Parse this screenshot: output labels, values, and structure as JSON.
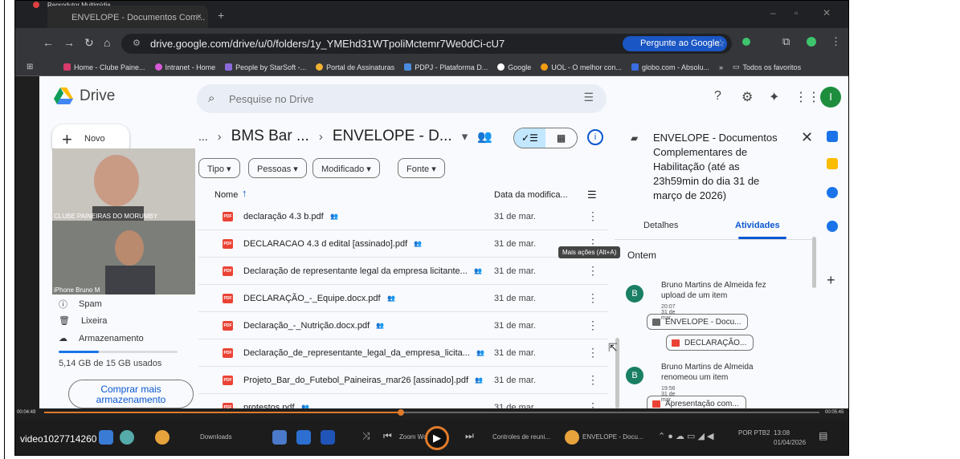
{
  "player": {
    "app_title": "Reprodutor Multimídia",
    "video_name": "video1027714260",
    "time_current": "00:04:49",
    "time_total": "00:05:45",
    "progress": 0.46
  },
  "browser": {
    "tab_title": "ENVELOPE - Documentos Com...",
    "url": "drive.google.com/drive/u/0/folders/1y_YMEhd31WTpoliMctemr7We0dCi-cU7",
    "ask_google": "Pergunte ao Google",
    "bookmarks": [
      "Home - Clube Paine...",
      "Intranet - Home",
      "People by StarSoft -...",
      "Portal de Assinaturas",
      "PDPJ - Plataforma D...",
      "Google",
      "UOL - O melhor con...",
      "globo.com - Absolu...",
      "»",
      "Todos os favoritos"
    ]
  },
  "drive": {
    "logo": "Drive",
    "search_placeholder": "Pesquise no Drive",
    "avatar_letter": "I",
    "new_label": "Novo",
    "nav": {
      "spam": "Spam",
      "trash": "Lixeira",
      "storage": "Armazenamento"
    },
    "storage_used": "5,14 GB de 15 GB usados",
    "storage_fraction": 0.34,
    "buy_more": "Comprar mais armazenamento",
    "cams": [
      {
        "label": "CLUBE PAINEIRAS DO MORUMBY"
      },
      {
        "label": "iPhone Bruno M"
      }
    ],
    "breadcrumb": [
      "...",
      "BMS Bar ...",
      "ENVELOPE - D..."
    ],
    "filters": [
      "Tipo",
      "Pessoas",
      "Modificado",
      "Fonte"
    ],
    "columns": {
      "name": "Nome",
      "date": "Data da modifica..."
    },
    "files": [
      {
        "name": "declaração 4.3 b.pdf",
        "date": "31 de mar."
      },
      {
        "name": "DECLARACAO 4.3 d edital [assinado].pdf",
        "date": "31 de mar."
      },
      {
        "name": "Declaração de representante legal da empresa licitante...",
        "date": "31 de mar."
      },
      {
        "name": "DECLARAÇÃO_-_Equipe.docx.pdf",
        "date": "31 de mar."
      },
      {
        "name": "Declaração_-_Nutrição.docx.pdf",
        "date": "31 de mar."
      },
      {
        "name": "Declaração_de_representante_legal_da_empresa_licita...",
        "date": "31 de mar."
      },
      {
        "name": "Projeto_Bar_do_Futebol_Paineiras_mar26 [assinado].pdf",
        "date": "31 de mar."
      },
      {
        "name": "protestos.pdf",
        "date": "31 de mar."
      }
    ],
    "tooltip": "Mais ações (Alt+A)",
    "panel": {
      "title": "ENVELOPE - Documentos Complementares de Habilitação (até as 23h59min do dia 31 de março de 2026)",
      "tab_details": "Detalhes",
      "tab_activity": "Atividades",
      "section": "Ontem",
      "activities": [
        {
          "avatar": "B",
          "text": "Bruno Martins de Almeida fez upload de um item",
          "time": "20:07 31 de mar.",
          "chips": [
            "ENVELOPE - Docu...",
            "DECLARAÇÃO..."
          ]
        },
        {
          "avatar": "B",
          "text": "Bruno Martins de Almeida renomeou um item",
          "time": "19:56 31 de mar.",
          "chips": [
            "Apresentação com..."
          ]
        }
      ]
    }
  },
  "taskbar": {
    "downloads": "Downloads",
    "zoom": "Zoom Workplace",
    "zoom_controls": "Controles de reuni...",
    "chrome_window": "ENVELOPE - Docu...",
    "lang": "POR PTB2",
    "clock": "13:08",
    "date": "01/04/2026"
  },
  "colors": {
    "accent": "#0b57d0",
    "pdf_red": "#ea4335",
    "seek_orange": "#e07b2a",
    "selected_toggle": "#c2e7ff"
  }
}
